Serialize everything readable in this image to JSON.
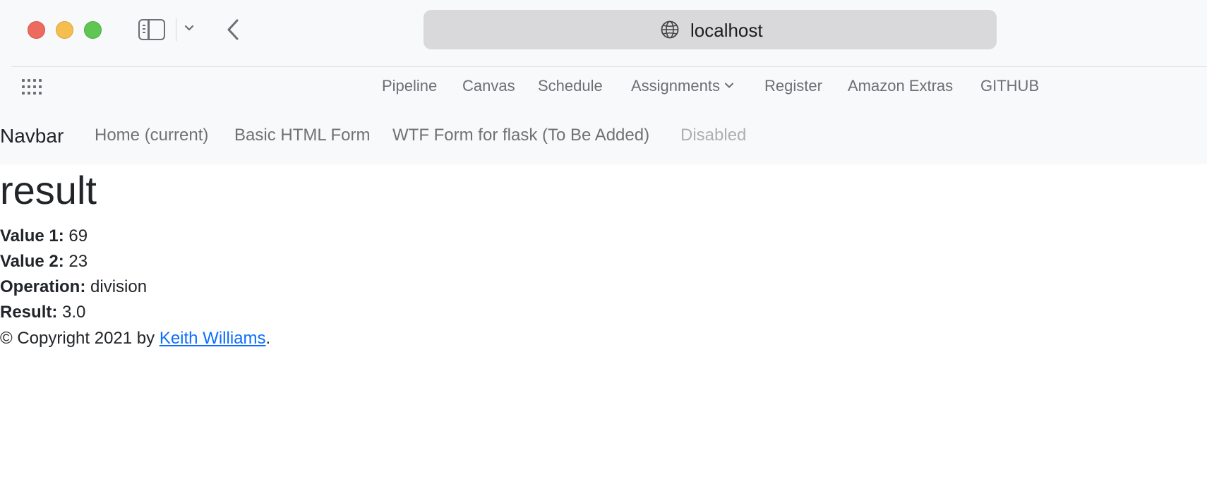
{
  "browser": {
    "url": "localhost",
    "favorites": [
      {
        "label": "Pipeline"
      },
      {
        "label": "Canvas"
      },
      {
        "label": "Schedule"
      },
      {
        "label": "Assignments"
      },
      {
        "label": "Register"
      },
      {
        "label": "Amazon Extras"
      },
      {
        "label": "GITHUB"
      }
    ]
  },
  "navbar": {
    "brand": "Navbar",
    "links": [
      {
        "label": "Home (current)"
      },
      {
        "label": "Basic HTML Form"
      },
      {
        "label": "WTF Form for flask (To Be Added)"
      },
      {
        "label": "Disabled"
      }
    ]
  },
  "content": {
    "title": "result",
    "fields": [
      {
        "label": "Value 1:",
        "value": "69"
      },
      {
        "label": "Value 2:",
        "value": "23"
      },
      {
        "label": "Operation:",
        "value": "division"
      },
      {
        "label": "Result:",
        "value": "3.0"
      }
    ]
  },
  "footer": {
    "prefix": "© Copyright 2021 by ",
    "author_link": "Keith Williams",
    "suffix": "."
  },
  "colors": {
    "chrome_bg": "#f8f9fa",
    "link": "#0d6efd",
    "traffic_red": "#ec6a5e",
    "traffic_yellow": "#f4bf4f",
    "traffic_green": "#61c554"
  }
}
